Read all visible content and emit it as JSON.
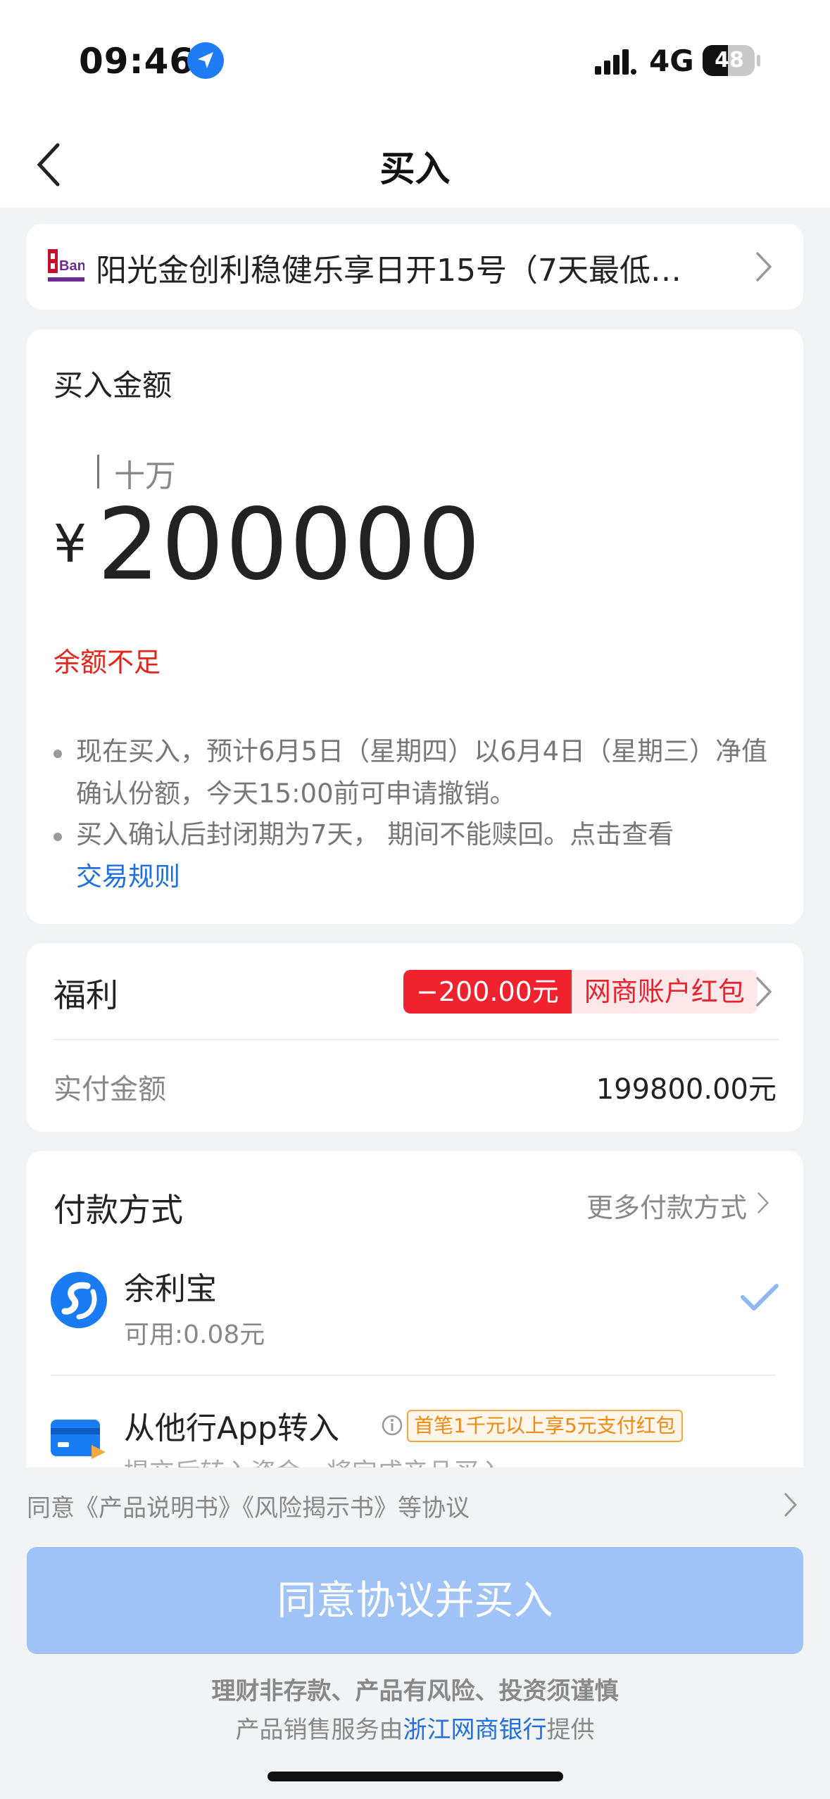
{
  "status_bar": {
    "time": "09:46",
    "network": "4G",
    "battery": "48"
  },
  "header": {
    "title": "买入"
  },
  "product": {
    "name": "阳光金创利稳健乐享日开15号（7天最低…",
    "logo_text": "Bank"
  },
  "amount": {
    "label": "买入金额",
    "unit_hint": "十万",
    "currency": "¥",
    "value": "200000",
    "warning": "余额不足",
    "notes": [
      "现在买入，预计6月5日（星期四）以6月4日（星期三）净值确认份额，今天15:00前可申请撤销。",
      "买入确认后封闭期为7天， 期间不能赎回。点击查看"
    ],
    "rules_link": "交易规则"
  },
  "welfare": {
    "label": "福利",
    "coupon_amount": "−200.00元",
    "coupon_desc": "网商账户红包",
    "pay_label": "实付金额",
    "pay_value": "199800.00元"
  },
  "payment": {
    "title": "付款方式",
    "more": "更多付款方式",
    "methods": [
      {
        "name": "余利宝",
        "detail": "可用:0.08元"
      },
      {
        "name": "从他行App转入",
        "promo": "首笔1千元以上享5元支付红包",
        "detail": "提交后转入资金，将完成产品买入"
      }
    ]
  },
  "footer": {
    "agreement": "同意《产品说明书》《风险揭示书》等协议",
    "buy_button": "同意协议并买入",
    "risk": "理财非存款、产品有风险、投资须谨慎",
    "provider_prefix": "产品销售服务由",
    "provider_bank": "浙江网商银行",
    "provider_suffix": "提供"
  },
  "colors": {
    "accent": "#1f6fe0",
    "warning": "#e1251b",
    "button": "#9fc3f6"
  }
}
